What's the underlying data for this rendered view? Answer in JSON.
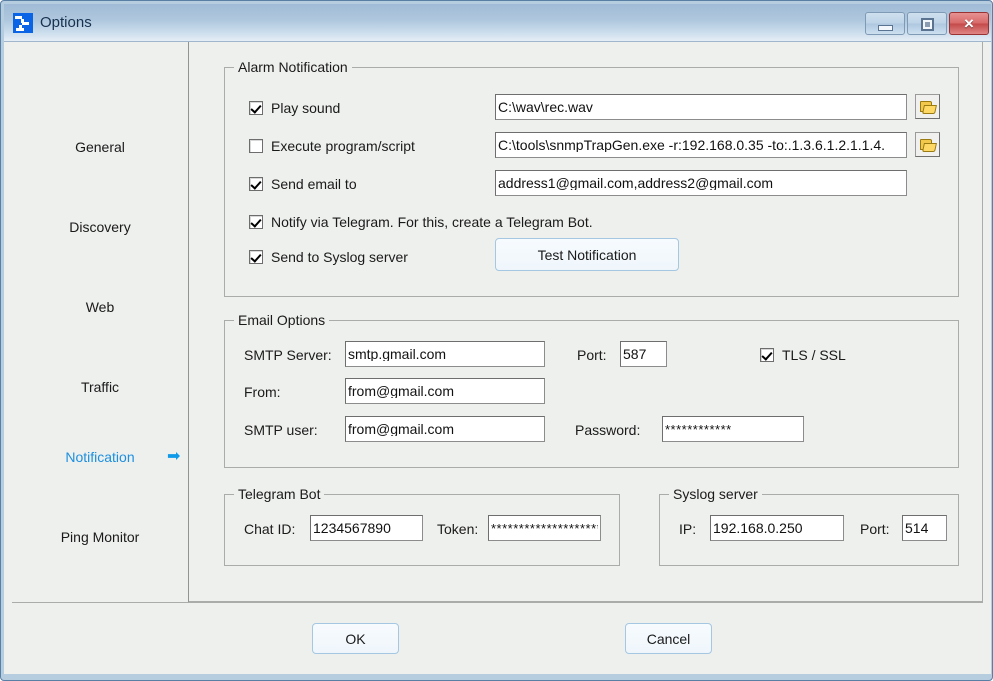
{
  "window": {
    "title": "Options",
    "icon": "app-network-icon",
    "buttons": {
      "minimize": "minimize-icon",
      "maximize": "maximize-icon",
      "close": "×"
    }
  },
  "sidebar": {
    "items": [
      {
        "label": "General",
        "active": false
      },
      {
        "label": "Discovery",
        "active": false
      },
      {
        "label": "Web",
        "active": false
      },
      {
        "label": "Traffic",
        "active": false
      },
      {
        "label": "Notification",
        "active": true
      },
      {
        "label": "Ping Monitor",
        "active": false
      }
    ],
    "active_arrow": "➡"
  },
  "alarm": {
    "legend": "Alarm Notification",
    "play_sound": {
      "label": "Play sound",
      "checked": true,
      "value": "C:\\wav\\rec.wav",
      "browse": "folder-icon"
    },
    "execute_program": {
      "label": "Execute program/script",
      "checked": false,
      "value": "C:\\tools\\snmpTrapGen.exe -r:192.168.0.35 -to:.1.3.6.1.2.1.1.4.",
      "browse": "folder-icon"
    },
    "send_email": {
      "label": "Send email to",
      "checked": true,
      "value": "address1@gmail.com,address2@gmail.com"
    },
    "notify_telegram": {
      "label": "Notify via Telegram. For this, create a Telegram Bot.",
      "checked": true
    },
    "send_syslog": {
      "label": "Send to Syslog server",
      "checked": true
    },
    "test_button": "Test Notification"
  },
  "email_options": {
    "legend": "Email Options",
    "smtp_server_label": "SMTP Server:",
    "smtp_server_value": "smtp.gmail.com",
    "port_label": "Port:",
    "port_value": "587",
    "tls_label": "TLS / SSL",
    "tls_checked": true,
    "from_label": "From:",
    "from_value": "from@gmail.com",
    "smtp_user_label": "SMTP user:",
    "smtp_user_value": "from@gmail.com",
    "password_label": "Password:",
    "password_value": "************"
  },
  "telegram": {
    "legend": "Telegram Bot",
    "chat_id_label": "Chat ID:",
    "chat_id_value": "1234567890",
    "token_label": "Token:",
    "token_value": "********************"
  },
  "syslog": {
    "legend": "Syslog server",
    "ip_label": "IP:",
    "ip_value": "192.168.0.250",
    "port_label": "Port:",
    "port_value": "514"
  },
  "footer": {
    "ok": "OK",
    "cancel": "Cancel"
  },
  "colors": {
    "accent": "#1d8fe0",
    "arrow": "#0e9ae8",
    "window_bg": "#eef0ed",
    "frame": "#b6ccdf",
    "close_red": "#c44a4a"
  }
}
